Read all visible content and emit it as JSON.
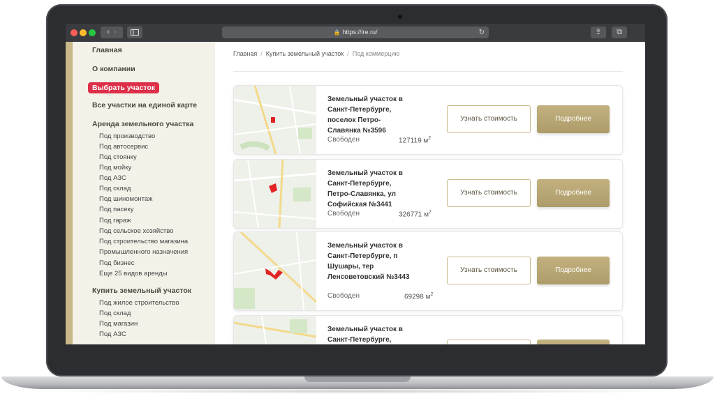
{
  "browser": {
    "url": "https://ire.ru/"
  },
  "sidebar": {
    "home": "Главная",
    "about": "О компании",
    "choose": "Выбрать участок",
    "all_on_map": "Все участки на единой карте",
    "rent_title": "Аренда земельного участка",
    "rent_items": [
      "Под производство",
      "Под автосервис",
      "Под стоянку",
      "Под мойку",
      "Под АЗС",
      "Под склад",
      "Под шиномонтаж",
      "Под пасеку",
      "Под гараж",
      "Под сельское хозяйство",
      "Под строительство магазина",
      "Промышленного назначения",
      "Под бизнес",
      "Еще 25 видов аренды"
    ],
    "buy_title": "Купить земельный участок",
    "buy_items": [
      "Под жилое строительство",
      "Под склад",
      "Под магазин",
      "Под АЗС"
    ]
  },
  "breadcrumb": {
    "home": "Главная",
    "buy": "Купить земельный участок",
    "current": "Под коммерцию"
  },
  "buttons": {
    "price": "Узнать стоимость",
    "more": "Подробнее"
  },
  "listings": [
    {
      "title": "Земельный участок в Санкт-Петербурге, поселок Петро-Славянка №3596",
      "status": "Свободен",
      "area": "127119 м",
      "area_unit_sup": "2"
    },
    {
      "title": "Земельный участок в Санкт-Петербурге, Петро-Славянка, ул Софийская №3441",
      "status": "Свободен",
      "area": "326771 м",
      "area_unit_sup": "2"
    },
    {
      "title": "Земельный участок в Санкт-Петербурге, п Шушары, тер Ленсоветовский №3443",
      "status": "Свободен",
      "area": "69298 м",
      "area_unit_sup": "2"
    },
    {
      "title": "Земельный участок в Санкт-Петербурге,"
    }
  ],
  "colors": {
    "accent_gold": "#c2b17f",
    "active_red": "#dd2f48",
    "sidebar_bg": "#f3f1e8"
  }
}
